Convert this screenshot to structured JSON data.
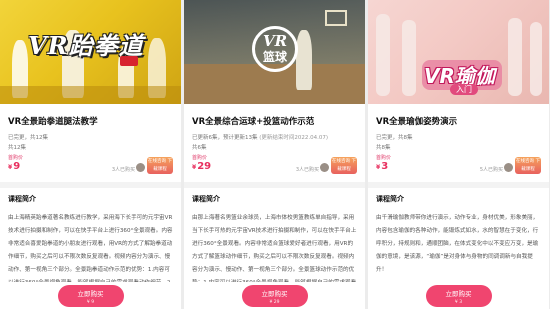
{
  "colors": {
    "accent": "#f0456f",
    "price": "#e8305f",
    "tag": "#e03c6b"
  },
  "courses": [
    {
      "cover_logo": "VR跆拳道",
      "title": "VR全景跆拳道腿法教学",
      "status": "已完更，共12集",
      "count": "共12集",
      "price_tag": "首购价",
      "currency": "¥",
      "price": "9",
      "buyers": "3人已购买",
      "group_buy": "在线咨询 下载课程",
      "section_title": "课程简介",
      "description": "由上海精英跆拳道著名教练进行教学，采用海下长手可的元宇宙VR技术进行拍摄和制作，可以在快手平台上进行360°全景观看。内容非常适合喜爱跆拳道的小朋友进行观看，用VR的方式了解跆拳道动作细节，购买之后可以不限次数反复观看。视频内容分为演示、慢动作、第一视角三个部分。全景跆拳道动作示范的优势：1.内容可以进行360°全景视角观看，能够根据自己的需求观看动作细节。2.简",
      "buy_label": "立即购买",
      "buy_price": "¥ 9"
    },
    {
      "cover_logo": "VR",
      "cover_logo_sub": "篮球",
      "title": "VR全景综合运球+投篮动作示范",
      "status": "已更新6集，预计更新13集",
      "status_note": "(更新结束时间2022.04.07)",
      "count": "共6集",
      "price_tag": "首购价",
      "currency": "¥",
      "price": "29",
      "buyers": "3人已购买",
      "group_buy": "在线咨询 下载课程",
      "section_title": "课程简介",
      "description": "由那上海著名男篮业余球员，上海市体校男篮教练单自指导，采用当下长手可热的元宇宙VR技术进行拍摄和制作，可以在快手平台上进行360°全景观看。内容非常适合篮球爱好者进行观看，用VR的方式了解篮球动作细节，购买之后可以不限次数反复观看。视频内容分为演示、慢动作、第一视角三个部分。全景篮球动作示范的优势：1.内容可以进行360°全景视角观看，能够根据自己的需求观看动作细节。",
      "buy_label": "立即购买",
      "buy_price": "¥ 29"
    },
    {
      "cover_logo": "VR瑜伽",
      "cover_logo_sub": "入门",
      "title": "VR全景瑜伽姿势演示",
      "status": "已完更，共8集",
      "count": "共8集",
      "price_tag": "首购价",
      "currency": "¥",
      "price": "3",
      "buyers": "5人已购买",
      "group_buy": "在线咨询 下载课程",
      "section_title": "课程简介",
      "description": "由千滑瑜伽教师带你进行演示，动作专业，身材优美，形象美丽，内容包含瑜伽的各种动作，能锻炼式如水，水的智慧在于变化，行呼积分，持规则和，通顺团脑，在体式变化中以不变应万变，是瑜伽的意境，是该源，“瑜伽”是对身体与身物的同调调新与自我提升！",
      "buy_label": "立即购买",
      "buy_price": "¥ 3"
    }
  ]
}
